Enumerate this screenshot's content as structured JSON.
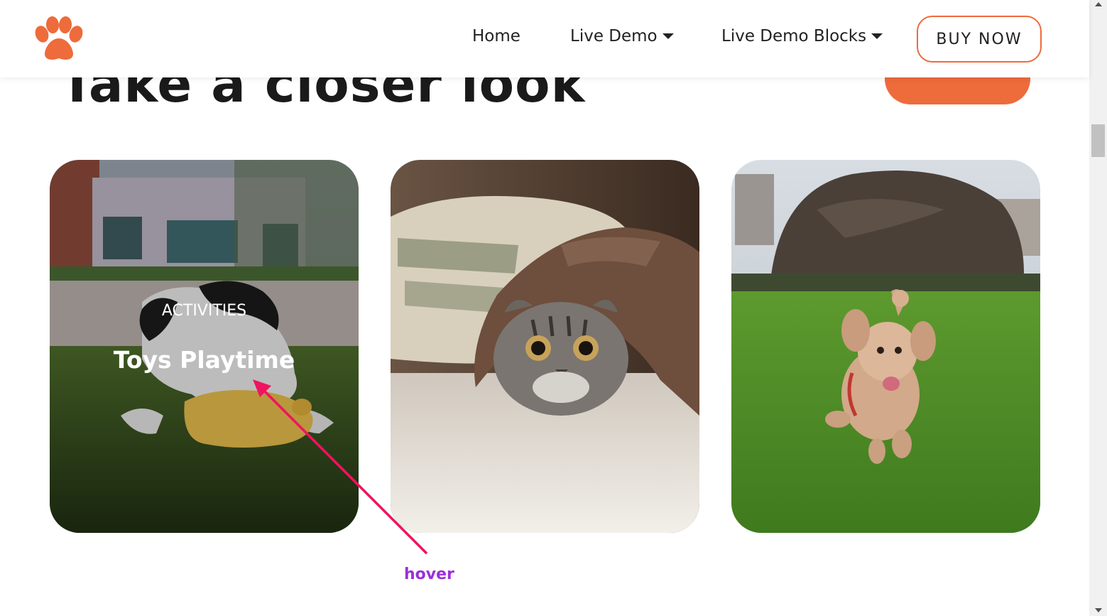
{
  "header": {
    "logo": "paw-icon",
    "nav": [
      {
        "label": "Home",
        "dropdown": false
      },
      {
        "label": "Live Demo",
        "dropdown": true
      },
      {
        "label": "Live Demo Blocks",
        "dropdown": true
      }
    ],
    "buy_label": "BUY NOW",
    "accent_color": "#ee6b3b"
  },
  "section": {
    "heading": "Take a closer look"
  },
  "cards": [
    {
      "category": "ACTIVITIES",
      "title": "Toys Playtime",
      "image": "dog-with-toy-photo",
      "hovered": true
    },
    {
      "category": "",
      "title": "",
      "image": "cat-under-blanket-photo",
      "hovered": false
    },
    {
      "category": "",
      "title": "",
      "image": "running-poodle-photo",
      "hovered": false
    }
  ],
  "annotation": {
    "label": "hover",
    "color": "#f0135f"
  }
}
